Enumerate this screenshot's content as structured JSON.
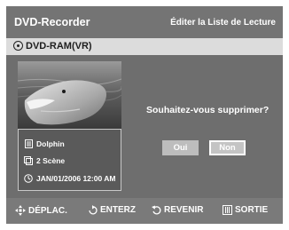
{
  "header": {
    "app_title": "DVD-Recorder",
    "page_title": "Éditer la Liste de Lecture"
  },
  "disc": {
    "label": "DVD-RAM(VR)",
    "icon": "disc-icon"
  },
  "title_info": {
    "name": "Dolphin",
    "scenes": "2 Scène",
    "datetime": "JAN/01/2006 12:00 AM"
  },
  "dialog": {
    "question": "Souhaitez-vous supprimer?",
    "yes_label": "Oui",
    "no_label": "Non",
    "selected": "Non"
  },
  "footer": {
    "move": "DÉPLAC.",
    "enter": "ENTERZ",
    "back": "REVENIR",
    "exit": "SORTIE"
  },
  "colors": {
    "screen_bg": "#6e6e6e",
    "header_bg": "#747474",
    "disc_bar_bg": "#dcdcdc",
    "button_bg": "#bdbdbd",
    "text": "#ffffff"
  }
}
